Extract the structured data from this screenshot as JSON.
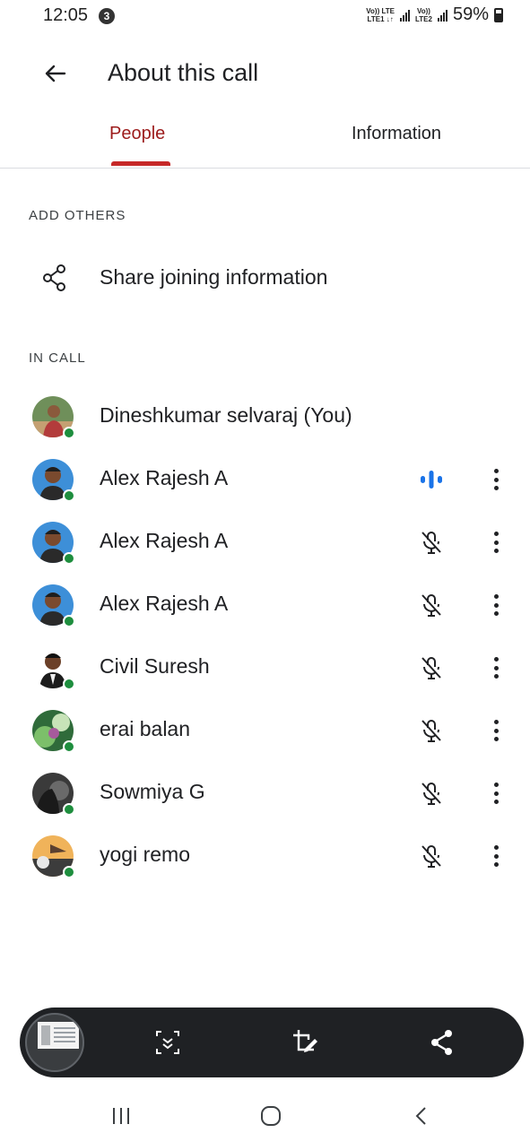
{
  "status_bar": {
    "time": "12:05",
    "notification_count": "3",
    "sim1_label_top": "Vo)) LTE",
    "sim1_label_bottom": "LTE1 ↓↑",
    "sim2_label_top": "Vo))",
    "sim2_label_bottom": "LTE2",
    "battery": "59%"
  },
  "app_bar": {
    "back_icon": "arrow-left-icon",
    "title": "About this call"
  },
  "tabs": [
    {
      "label": "People",
      "selected": true
    },
    {
      "label": "Information",
      "selected": false
    }
  ],
  "add_others": {
    "heading": "ADD OTHERS",
    "share_icon": "share-icon",
    "share_label": "Share joining information"
  },
  "in_call": {
    "heading": "IN CALL",
    "participants": [
      {
        "name": "Dineshkumar selvaraj (You)",
        "mic": "none",
        "more": false
      },
      {
        "name": "Alex Rajesh A",
        "mic": "speaking",
        "more": true
      },
      {
        "name": "Alex Rajesh A",
        "mic": "muted",
        "more": true
      },
      {
        "name": "Alex Rajesh A",
        "mic": "muted",
        "more": true
      },
      {
        "name": "Civil Suresh",
        "mic": "muted",
        "more": true
      },
      {
        "name": "erai balan",
        "mic": "muted",
        "more": true
      },
      {
        "name": "Sowmiya G",
        "mic": "muted",
        "more": true
      },
      {
        "name": "yogi remo",
        "mic": "muted",
        "more": true
      }
    ]
  },
  "screenshot_toolbar": {
    "items": [
      "thumbnail",
      "scroll-capture-icon",
      "edit-crop-icon",
      "share-icon"
    ]
  },
  "nav_bar": {
    "items": [
      "recent-apps-icon",
      "home-icon",
      "back-icon"
    ]
  },
  "colors": {
    "accent": "#c62828",
    "tab_selected_text": "#9c1b1b",
    "speaking": "#1a73e8",
    "presence": "#1e8e3e",
    "toolbar_bg": "#1f2124"
  }
}
